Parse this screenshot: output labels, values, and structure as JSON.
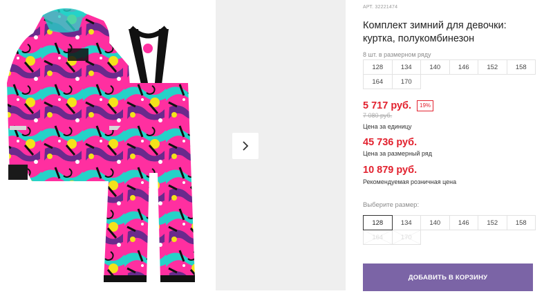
{
  "product": {
    "sku": "АРТ. 32221474",
    "title": "Комплект зимний для девочки: куртка, полукомбинезон"
  },
  "pack": {
    "note": "8 шт. в размерном ряду",
    "sizes": [
      "128",
      "134",
      "140",
      "146",
      "152",
      "158",
      "164",
      "170"
    ]
  },
  "pricing": {
    "unit_price": "5 717 руб.",
    "discount": "19%",
    "old_price": "7 080 руб.",
    "unit_caption": "Цена за единицу",
    "pack_price": "45 736 руб.",
    "pack_caption": "Цена за размерный ряд",
    "retail_price": "10 879 руб.",
    "retail_caption": "Рекомендуемая розничная цена"
  },
  "size_select": {
    "label": "Выберите размер:",
    "selected": "128",
    "options": [
      "128",
      "134",
      "140",
      "146",
      "152",
      "158",
      "164",
      "170"
    ],
    "disabled": [
      "164",
      "170"
    ]
  },
  "cart": {
    "button_label": "ДОБАВИТЬ В КОРЗИНУ"
  },
  "gallery": {
    "next_icon": "chevron-right-icon"
  },
  "colors": {
    "accent": "#7b64a6",
    "price_red": "#e2212e",
    "pink": "#ff2fa0",
    "turquoise": "#25d2c8",
    "yellow": "#f4e21a",
    "purple": "#6a2a8c"
  }
}
